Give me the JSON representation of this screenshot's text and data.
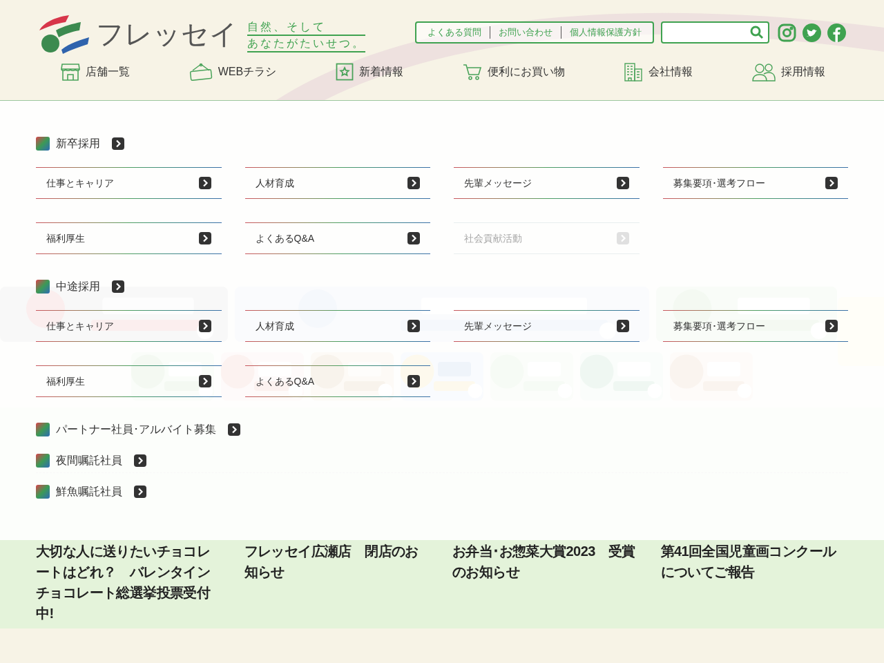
{
  "logo": {
    "name": "フレッセイ",
    "tagline": [
      "自然、そして",
      "あなたがたいせつ。"
    ]
  },
  "utility_links": [
    "よくある質問",
    "お問い合わせ",
    "個人情報保護方針"
  ],
  "main_nav": [
    "店舗一覧",
    "WEBチラシ",
    "新着情報",
    "便利にお買い物",
    "会社情報",
    "採用情報"
  ],
  "recruit_menu": {
    "sections": [
      {
        "title": "新卒採用",
        "links": [
          {
            "label": "仕事とキャリア",
            "disabled": false
          },
          {
            "label": "人材育成",
            "disabled": false
          },
          {
            "label": "先輩メッセージ",
            "disabled": false
          },
          {
            "label": "募集要項･選考フロー",
            "disabled": false
          },
          {
            "label": "福利厚生",
            "disabled": false
          },
          {
            "label": "よくあるQ&A",
            "disabled": false
          },
          {
            "label": "社会貢献活動",
            "disabled": true
          }
        ]
      },
      {
        "title": "中途採用",
        "links": [
          {
            "label": "仕事とキャリア",
            "disabled": false
          },
          {
            "label": "人材育成",
            "disabled": false
          },
          {
            "label": "先輩メッセージ",
            "disabled": false
          },
          {
            "label": "募集要項･選考フロー",
            "disabled": false
          },
          {
            "label": "福利厚生",
            "disabled": false
          },
          {
            "label": "よくあるQ&A",
            "disabled": false
          }
        ]
      },
      {
        "title": "パートナー社員･アルバイト募集"
      },
      {
        "title": "夜間嘱託社員"
      },
      {
        "title": "鮮魚嘱託社員"
      }
    ]
  },
  "news": {
    "items": [
      {
        "title": "大切な人に送りたいチョコレートはどれ？　バレンタインチョコレート総選挙投票受付中!"
      },
      {
        "title": "フレッセイ広瀬店　閉店のお知らせ"
      },
      {
        "title": "お弁当･お惣菜大賞2023　受賞のお知らせ"
      },
      {
        "title": "第41回全国児童画コンクールについてご報告"
      }
    ]
  }
}
